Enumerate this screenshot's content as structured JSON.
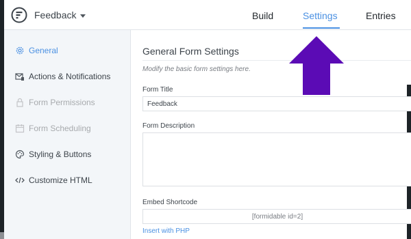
{
  "header": {
    "form_name": "Feedback",
    "tabs": [
      {
        "label": "Build"
      },
      {
        "label": "Settings",
        "active": true
      },
      {
        "label": "Entries"
      }
    ]
  },
  "sidebar": {
    "items": [
      {
        "label": "General",
        "icon": "gear-icon",
        "active": true
      },
      {
        "label": "Actions & Notifications",
        "icon": "notification-icon"
      },
      {
        "label": "Form Permissions",
        "icon": "lock-icon",
        "disabled": true
      },
      {
        "label": "Form Scheduling",
        "icon": "calendar-icon",
        "disabled": true
      },
      {
        "label": "Styling & Buttons",
        "icon": "palette-icon"
      },
      {
        "label": "Customize HTML",
        "icon": "code-icon"
      }
    ]
  },
  "main": {
    "title": "General Form Settings",
    "subtitle": "Modify the basic form settings here.",
    "form_title_label": "Form Title",
    "form_title_value": "Feedback",
    "form_description_label": "Form Description",
    "form_description_value": "",
    "embed_label": "Embed Shortcode",
    "embed_value": "[formidable id=2]",
    "insert_php_link": "Insert with PHP"
  },
  "colors": {
    "accent": "#4a90e2",
    "arrow": "#5b0bb5",
    "sidebar_bg": "#f3f6f9"
  }
}
